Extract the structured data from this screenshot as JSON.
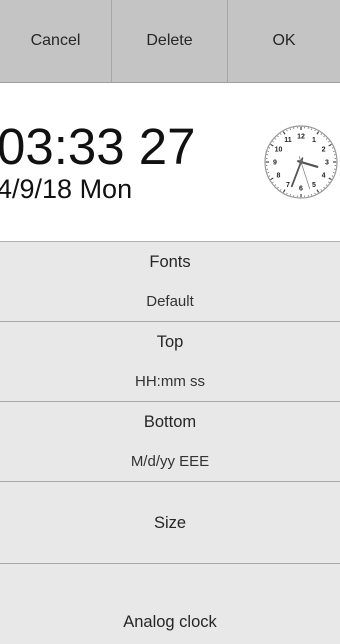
{
  "toolbar": {
    "cancel_label": "Cancel",
    "delete_label": "Delete",
    "ok_label": "OK"
  },
  "preview": {
    "time": "03:33 27",
    "date": "4/9/18 Mon",
    "analog_clock": {
      "hour": 3,
      "minute": 33,
      "second": 27,
      "numbers": [
        "12",
        "1",
        "2",
        "3",
        "4",
        "5",
        "6",
        "7",
        "8",
        "9",
        "10",
        "11"
      ]
    }
  },
  "settings": [
    {
      "name": "Fonts",
      "value": "Default"
    },
    {
      "name": "Top",
      "value": "HH:mm ss"
    },
    {
      "name": "Bottom",
      "value": "M/d/yy EEE"
    },
    {
      "name": "Size"
    },
    {
      "name": "Analog clock"
    }
  ],
  "colors": {
    "toolbar_bg": "#c4c4c4",
    "list_bg": "#e8e8e8",
    "preview_bg": "#ffffff"
  }
}
